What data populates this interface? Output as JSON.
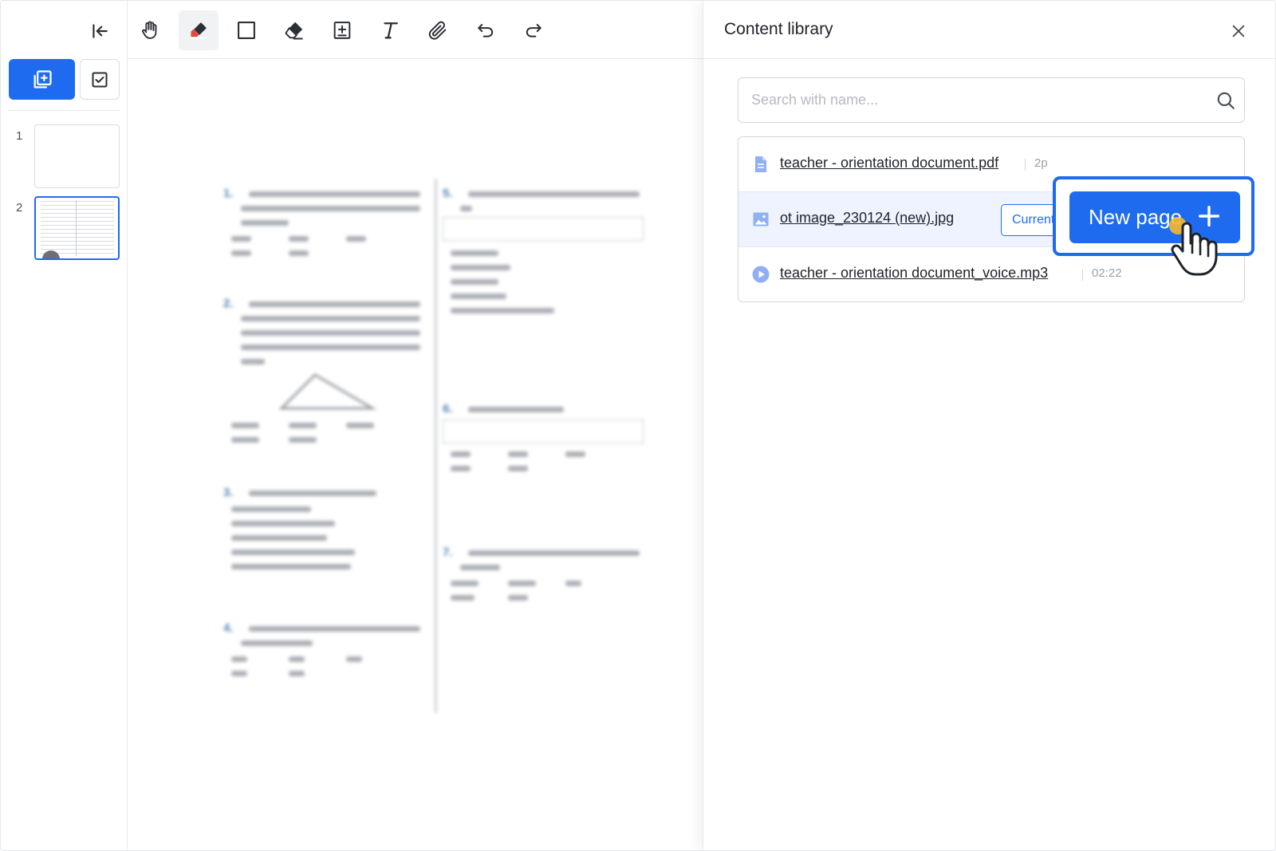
{
  "sidebar": {
    "pages": [
      {
        "number": "1"
      },
      {
        "number": "2"
      }
    ]
  },
  "toolbar": {
    "tools": [
      {
        "name": "hand-tool",
        "icon": "hand-icon"
      },
      {
        "name": "pen-tool",
        "icon": "pen-icon",
        "active": true
      },
      {
        "name": "shape-tool",
        "icon": "square-icon"
      },
      {
        "name": "eraser-tool",
        "icon": "eraser-icon"
      },
      {
        "name": "insert-box-tool",
        "icon": "add-box-icon"
      },
      {
        "name": "text-tool",
        "icon": "text-icon"
      },
      {
        "name": "attach-tool",
        "icon": "paperclip-icon"
      },
      {
        "name": "undo-tool",
        "icon": "undo-icon"
      },
      {
        "name": "redo-tool",
        "icon": "redo-icon"
      }
    ]
  },
  "document": {
    "questions": [
      "1.",
      "2.",
      "3.",
      "4.",
      "5.",
      "6.",
      "7."
    ]
  },
  "panel": {
    "title": "Content library",
    "search": {
      "placeholder": "Search with name...",
      "value": ""
    },
    "items": [
      {
        "name": "teacher - orientation document.pdf",
        "meta": "2p",
        "icon": "document-icon"
      },
      {
        "name": "ot image_230124 (new).jpg",
        "meta": "",
        "icon": "image-icon",
        "selected": true,
        "action_label": "Current"
      },
      {
        "name": "teacher - orientation document_voice.mp3",
        "meta": "02:22",
        "icon": "play-icon"
      }
    ],
    "new_page_label": "New page"
  },
  "colors": {
    "accent": "#1f6bf0",
    "selected_row": "#eef3ff",
    "eraser_pen_red": "#e8473d",
    "file_icon": "#8fb0f5"
  }
}
